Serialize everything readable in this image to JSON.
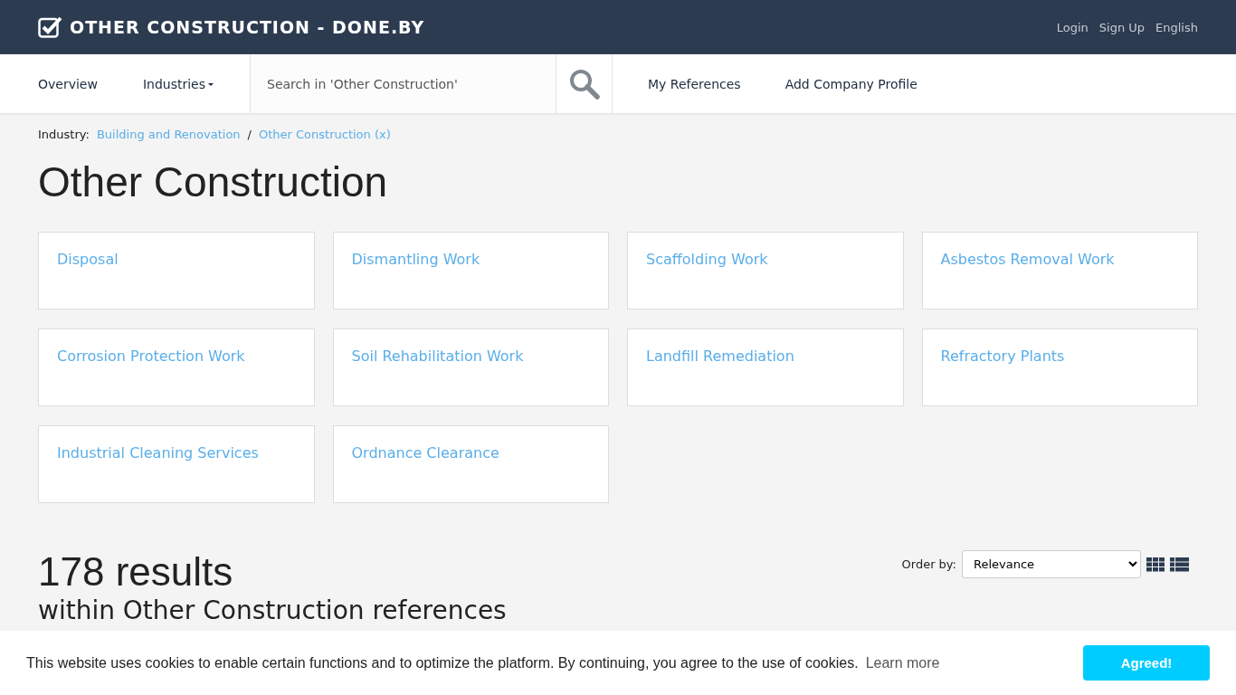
{
  "header": {
    "logo": "OTHER CONSTRUCTION - DONE.BY",
    "links": [
      "Login",
      "Sign Up",
      "English"
    ]
  },
  "nav": {
    "items": [
      {
        "label": "Overview",
        "dropdown": false
      },
      {
        "label": "Industries",
        "dropdown": true
      }
    ],
    "search": {
      "placeholder": "Search in 'Other Construction'"
    },
    "right_items": [
      "My References",
      "Add Company Profile"
    ]
  },
  "breadcrumb": {
    "label": "Industry:",
    "links": [
      "Building and Renovation",
      "Other Construction (x)"
    ],
    "separator": "/"
  },
  "title": "Other Construction",
  "categories": [
    "Disposal",
    "Dismantling Work",
    "Scaffolding Work",
    "Asbestos Removal Work",
    "Corrosion Protection Work",
    "Soil Rehabilitation Work",
    "Landfill Remediation",
    "Refractory Plants",
    "Industrial Cleaning Services",
    "Ordnance Clearance"
  ],
  "results": {
    "count": "178 results",
    "subtitle": "within Other Construction references",
    "order_label": "Order by:",
    "order_value": "Relevance"
  },
  "cookie_bar": {
    "message": "This website uses cookies to enable certain functions and to optimize the platform. By continuing, you agree to the use of cookies.",
    "link": "Learn more",
    "button": "Agreed!"
  }
}
